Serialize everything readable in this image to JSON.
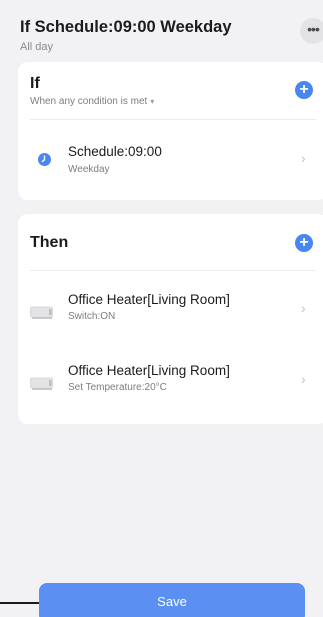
{
  "header": {
    "title": "If Schedule:09:00 Weekday",
    "subtitle": "All day",
    "more_icon": "more-icon",
    "more_glyph": "•••"
  },
  "if_section": {
    "title": "If",
    "condition_hint": "When any condition is met",
    "caret_glyph": "▾",
    "add_glyph": "+",
    "items": [
      {
        "title": "Schedule:09:00",
        "subtitle": "Weekday",
        "icon": "clock-icon"
      }
    ]
  },
  "then_section": {
    "title": "Then",
    "add_glyph": "+",
    "items": [
      {
        "title": "Office Heater[Living Room]",
        "subtitle": "Switch:ON",
        "icon": "heater-icon"
      },
      {
        "title": "Office Heater[Living Room]",
        "subtitle": "Set Temperature:20°C",
        "icon": "heater-icon"
      }
    ]
  },
  "chevron_glyph": "›",
  "save_label": "Save",
  "colors": {
    "accent": "#4a86f0",
    "save_button": "#5b8ff2",
    "background": "#f2f2f4"
  }
}
